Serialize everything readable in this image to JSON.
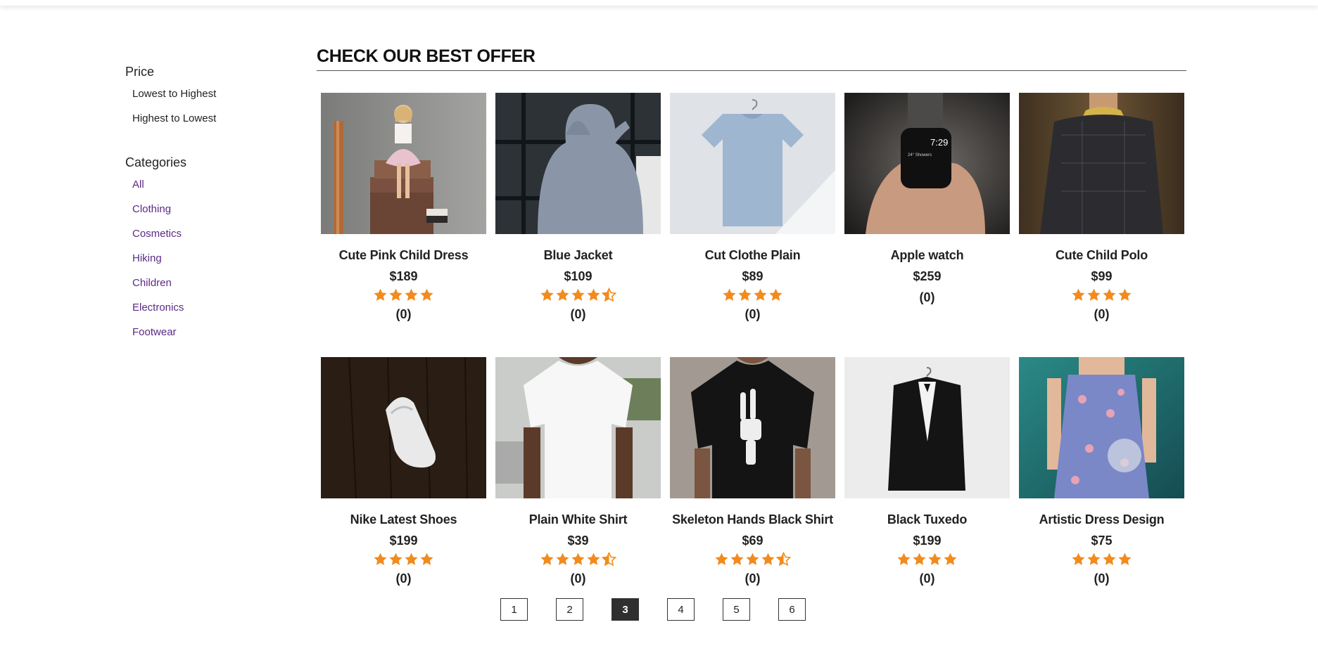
{
  "sidebar": {
    "price_heading": "Price",
    "price_options": [
      "Lowest to Highest",
      "Highest to Lowest"
    ],
    "categories_heading": "Categories",
    "categories": [
      "All",
      "Clothing",
      "Cosmetics",
      "Hiking",
      "Children",
      "Electronics",
      "Footwear"
    ]
  },
  "main": {
    "title": "CHECK OUR BEST OFFER"
  },
  "products": [
    {
      "name": "Cute Pink Child Dress",
      "price": "$189",
      "rating": 4,
      "reviews": "(0)",
      "image": "girl-pink-dress-photo"
    },
    {
      "name": "Blue Jacket",
      "price": "$109",
      "rating": 4.5,
      "reviews": "(0)",
      "image": "grey-hoodie-photo"
    },
    {
      "name": "Cut Clothe Plain",
      "price": "$89",
      "rating": 4,
      "reviews": "(0)",
      "image": "blue-tshirt-hanger-photo"
    },
    {
      "name": "Apple watch",
      "price": "$259",
      "rating": 0,
      "reviews": "(0)",
      "image": "apple-watch-photo"
    },
    {
      "name": "Cute Child Polo",
      "price": "$99",
      "rating": 4,
      "reviews": "(0)",
      "image": "child-polo-photo"
    },
    {
      "name": "Nike Latest Shoes",
      "price": "$199",
      "rating": 4,
      "reviews": "(0)",
      "image": "white-sneaker-photo"
    },
    {
      "name": "Plain White Shirt",
      "price": "$39",
      "rating": 4.5,
      "reviews": "(0)",
      "image": "white-tshirt-photo"
    },
    {
      "name": "Skeleton Hands Black Shirt",
      "price": "$69",
      "rating": 4.5,
      "reviews": "(0)",
      "image": "skeleton-shirt-photo"
    },
    {
      "name": "Black Tuxedo",
      "price": "$199",
      "rating": 4,
      "reviews": "(0)",
      "image": "black-tuxedo-photo"
    },
    {
      "name": "Artistic Dress Design",
      "price": "$75",
      "rating": 4,
      "reviews": "(0)",
      "image": "floral-dress-photo"
    }
  ],
  "pagination": {
    "pages": [
      "1",
      "2",
      "3",
      "4",
      "5",
      "6"
    ],
    "current": "3"
  },
  "colors": {
    "star": "#f28b1e",
    "category_link": "#5b2a86",
    "active_page": "#2f2f2f"
  }
}
